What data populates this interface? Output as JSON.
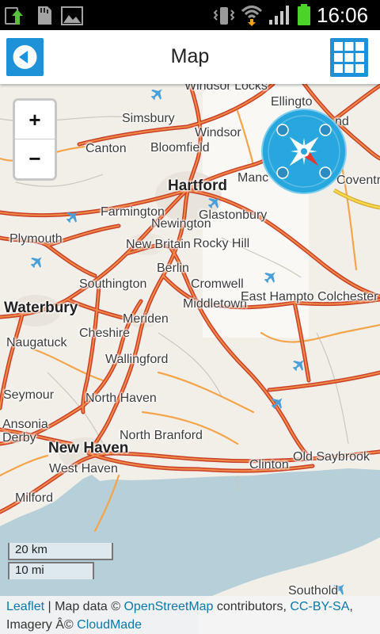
{
  "status_bar": {
    "time": "16:06",
    "left_icons": [
      "upload-icon",
      "sd-card-icon",
      "gallery-icon"
    ],
    "right_icons": [
      "vibrate-icon",
      "wifi-icon",
      "signal-icon",
      "battery-icon"
    ],
    "battery_color": "#4cd32a"
  },
  "header": {
    "title": "Map",
    "back_icon": "back-arrow-icon",
    "menu_icon": "grid-menu-icon",
    "accent_color": "#1d92d8"
  },
  "map": {
    "zoom_in": "+",
    "zoom_out": "−",
    "compass_icon": "compass-icon",
    "airport_icon": "airport-icon",
    "places": [
      "Windsor Locks",
      "Ellingto",
      "nd",
      "Simsbury",
      "Windsor",
      "Canton",
      "Bloomfield",
      "Hartford",
      "Manc",
      "Coventr",
      "Farmington",
      "Glastonbury",
      "Newington",
      "Plymouth",
      "New Britain",
      "Rocky Hill",
      "Berlin",
      "Southington",
      "Cromwell",
      "Middletown",
      "East Hampto",
      "Colchester",
      "Waterbury",
      "Meriden",
      "Cheshire",
      "Naugatuck",
      "Wallingford",
      "Seymour",
      "North Haven",
      "Ansonia",
      "Derby",
      "North Branford",
      "New Haven",
      "Old Saybrook",
      "Clinton",
      "West Haven",
      "Milford",
      "Southold"
    ],
    "scale": {
      "metric": "20 km",
      "imperial": "10 mi"
    },
    "colors": {
      "land": "#f2efe9",
      "water": "#b7cfd9",
      "highway": "#e0562d",
      "road": "#f3a54c",
      "airport": "#4a9fd8",
      "compass": "#27a7dd"
    }
  },
  "attribution": {
    "leaflet": "Leaflet",
    "sep1": " | Map data © ",
    "osm": "OpenStreetMap",
    "sep2": " contributors, ",
    "license": "CC-BY-SA",
    "sep3": ",",
    "imagery": "Imagery Â© ",
    "cloudmade": "CloudMade"
  }
}
